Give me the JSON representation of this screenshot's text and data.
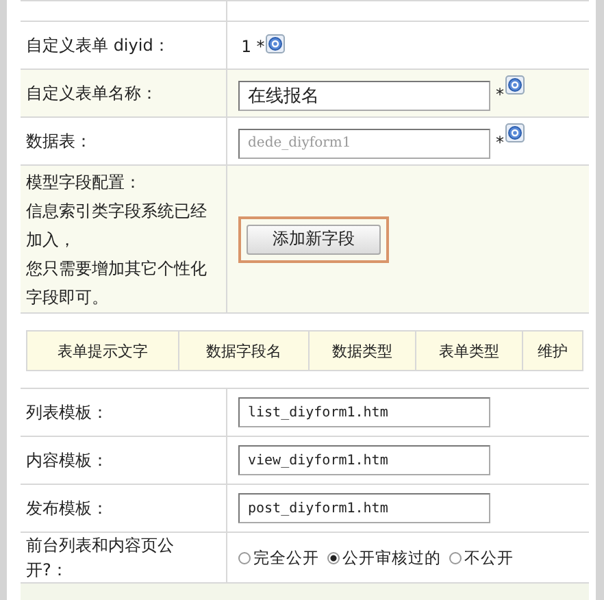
{
  "rows": [
    {
      "kind": "static",
      "label": "自定义表单 diyid：",
      "value": "1",
      "required_mark": "*",
      "help": true
    },
    {
      "kind": "input",
      "label": "自定义表单名称：",
      "value": "在线报名",
      "disabled": false,
      "required_mark": "*",
      "help": true
    },
    {
      "kind": "input",
      "label": "数据表：",
      "value": "dede_diyform1",
      "disabled": true,
      "required_mark": "*",
      "help": true
    },
    {
      "kind": "button",
      "label_lines": [
        "模型字段配置：",
        "信息索引类字段系统已经加入，",
        "您只需要增加其它个性化字段即可。"
      ],
      "button": "添加新字段",
      "highlighted": true
    },
    {
      "kind": "fields_table",
      "columns": [
        "表单提示文字",
        "数据字段名",
        "数据类型",
        "表单类型",
        "维护"
      ]
    },
    {
      "kind": "input",
      "label": "列表模板：",
      "value": "list_diyform1.htm",
      "disabled": false
    },
    {
      "kind": "input",
      "label": "内容模板：",
      "value": "view_diyform1.htm",
      "disabled": false
    },
    {
      "kind": "input",
      "label": "发布模板：",
      "value": "post_diyform1.htm",
      "disabled": false
    },
    {
      "kind": "radio",
      "label": "前台列表和内容页公开?：",
      "options": [
        {
          "label": "完全公开",
          "selected": false
        },
        {
          "label": "公开审核过的",
          "selected": true
        },
        {
          "label": "不公开",
          "selected": false
        }
      ]
    }
  ]
}
